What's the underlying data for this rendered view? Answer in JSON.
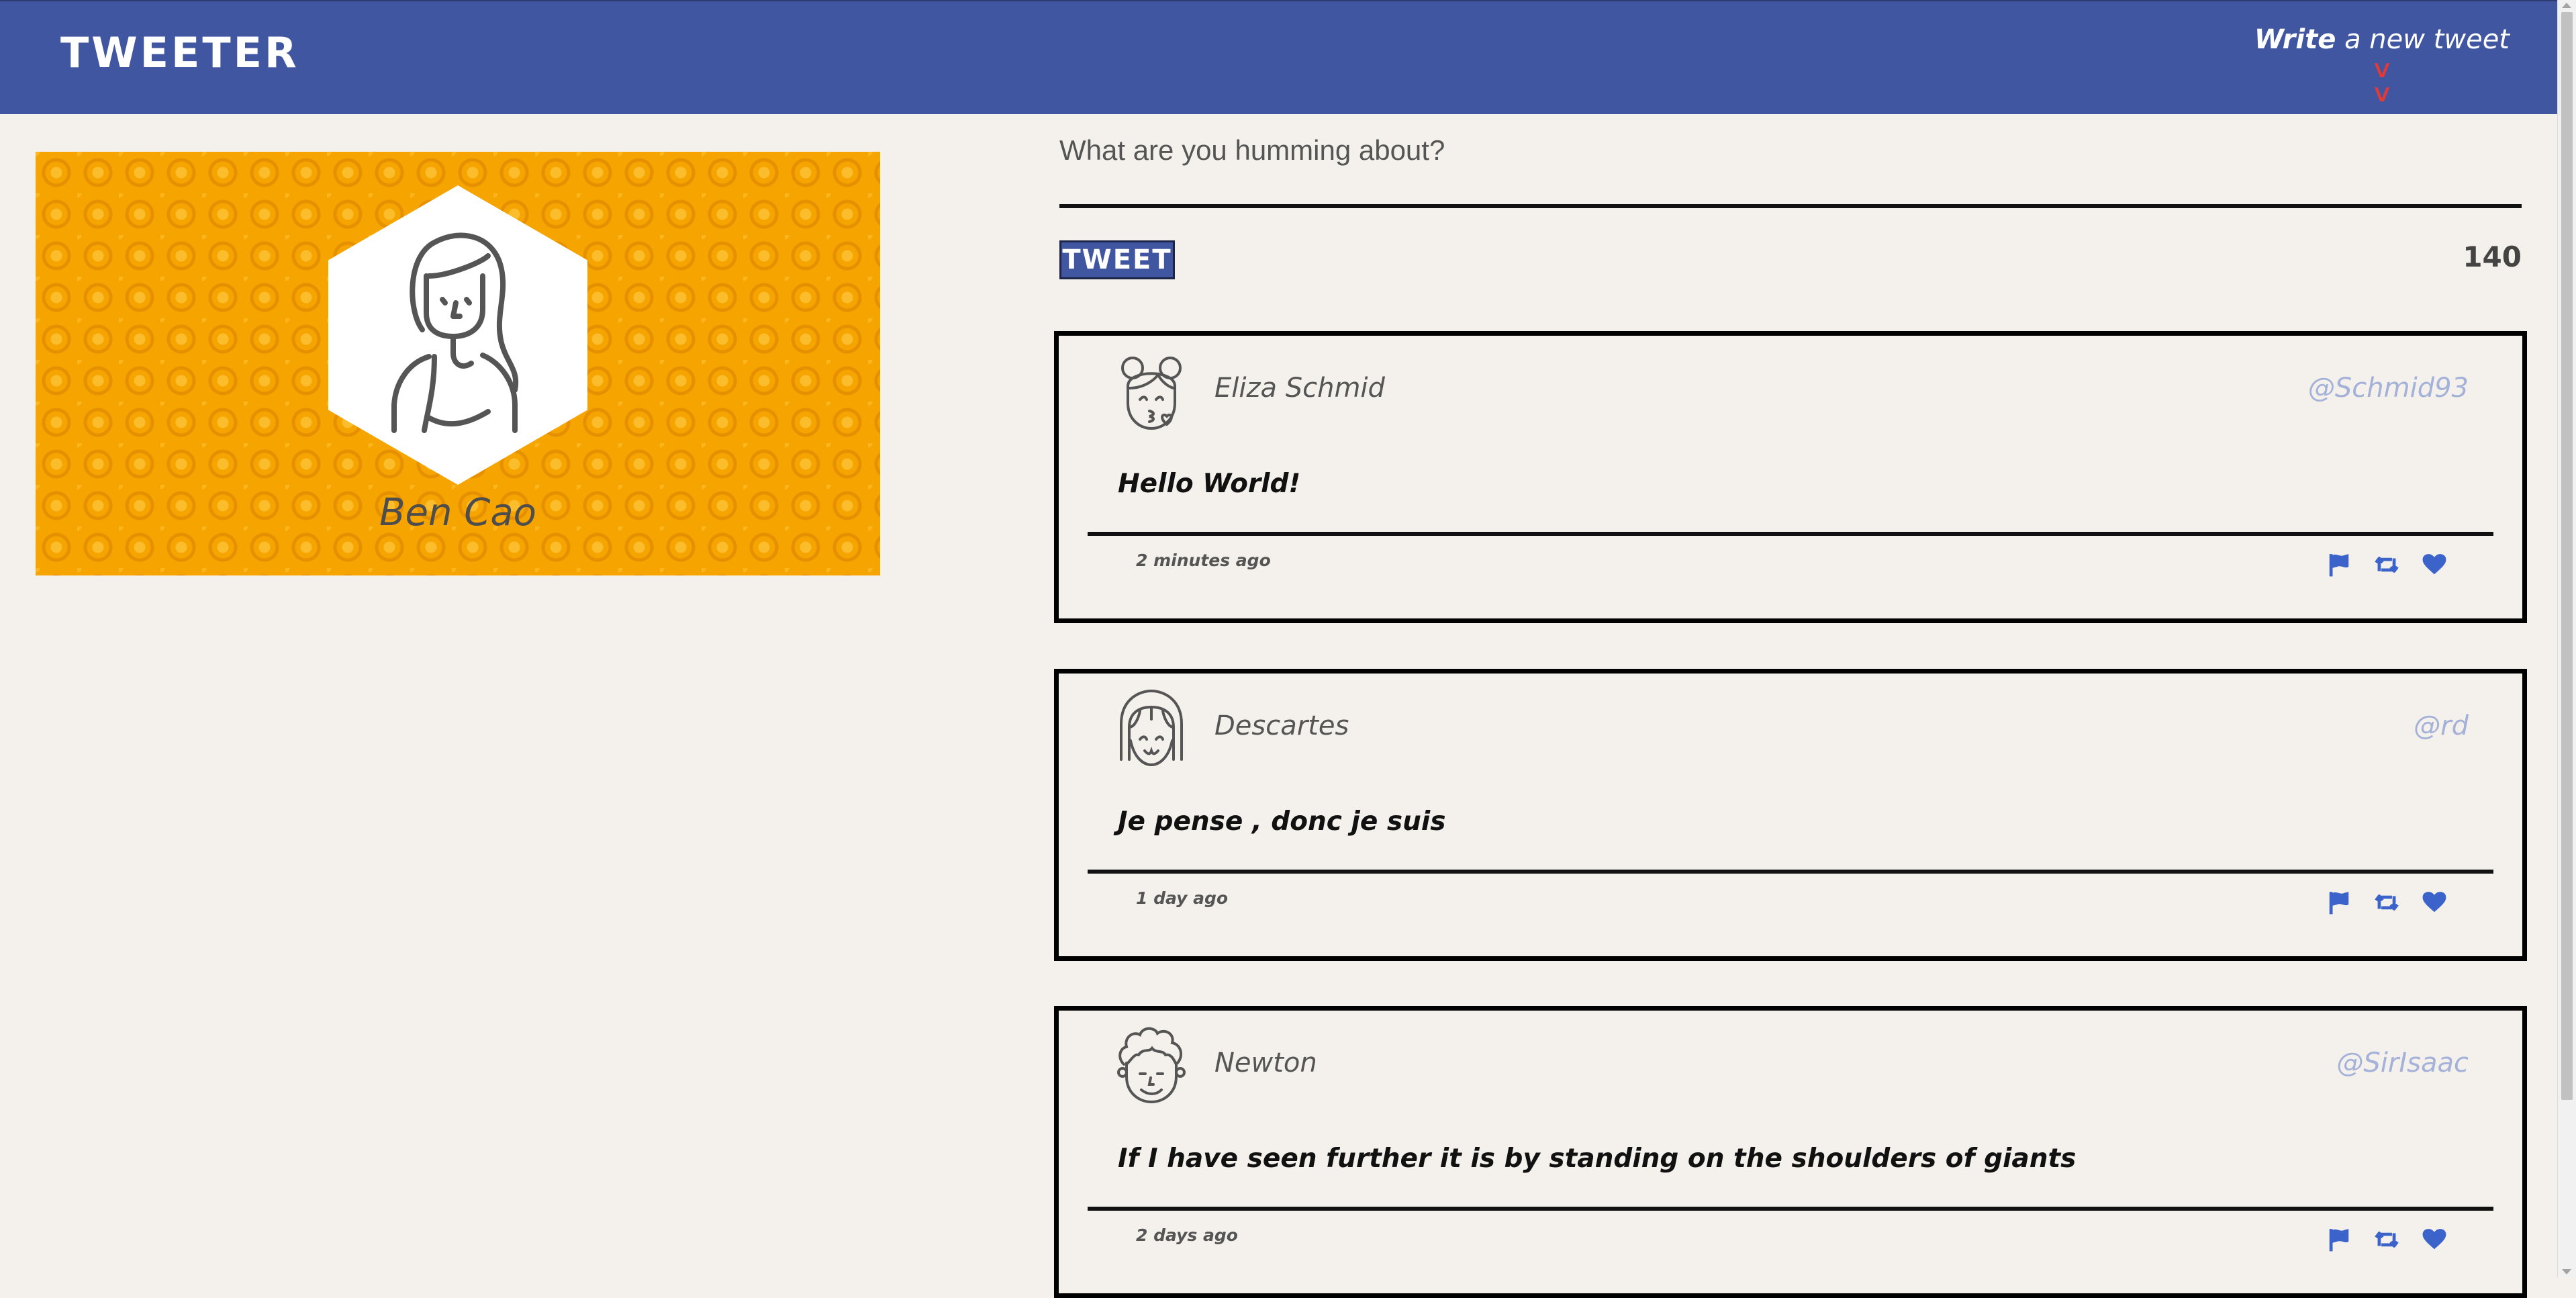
{
  "nav": {
    "brand": "Tweeter",
    "compose_bold": "Write",
    "compose_rest": " a new tweet",
    "compose_icon": "double-chevron-down-icon"
  },
  "profile": {
    "name": "Ben Cao",
    "banner_color": "#f6a400"
  },
  "compose": {
    "placeholder": "What are you humming about?",
    "value": "",
    "button_label": "Tweet",
    "counter": "140"
  },
  "colors": {
    "nav": "#4056a1",
    "accent_icons": "#3b63c9",
    "handle": "#a4b1d8",
    "chevron": "#e53935"
  },
  "tweets": [
    {
      "name": "Eliza Schmid",
      "handle": "@Schmid93",
      "content": "Hello World!",
      "time": "2 minutes ago",
      "avatar": "girl-with-buns-avatar-icon"
    },
    {
      "name": "Descartes",
      "handle": "@rd",
      "content": "Je pense , donc je suis",
      "time": "1 day ago",
      "avatar": "bob-hair-avatar-icon"
    },
    {
      "name": "Newton",
      "handle": "@SirIsaac",
      "content": "If I have seen further it is by standing on the shoulders of giants",
      "time": "2 days ago",
      "avatar": "curly-hair-avatar-icon"
    }
  ],
  "tweet_actions": [
    "flag-icon",
    "retweet-icon",
    "heart-icon"
  ]
}
